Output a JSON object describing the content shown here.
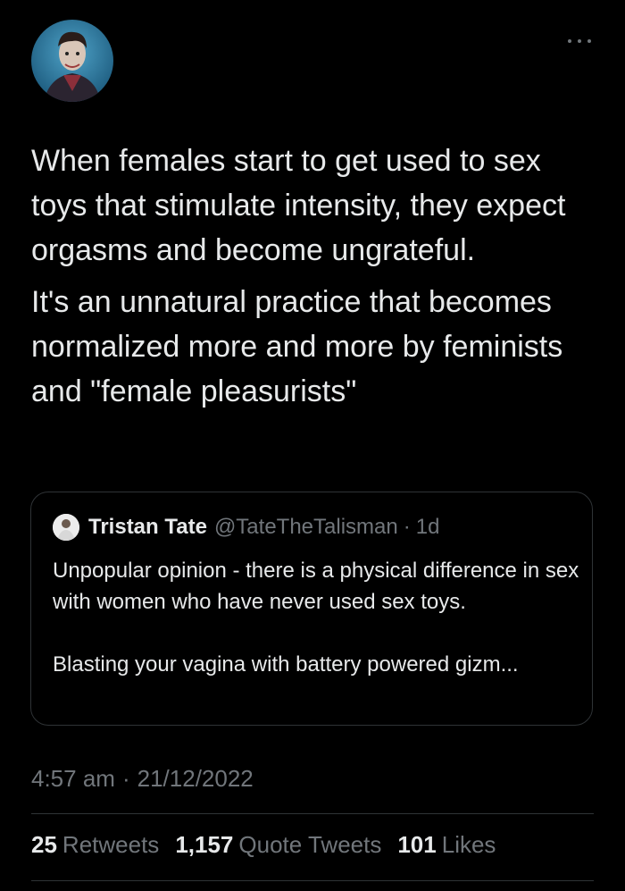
{
  "tweet": {
    "paragraphs": [
      "When females start to get used to sex toys that stimulate intensity, they expect orgasms and become ungrateful.",
      "It's an unnatural practice that becomes normalized more and more by feminists and \"female pleasurists\""
    ],
    "timestamp_time": "4:57 am",
    "separator": "·",
    "timestamp_date": "21/12/2022"
  },
  "quote": {
    "name": "Tristan Tate",
    "handle": "@TateTheTalisman",
    "separator": "·",
    "time": "1d",
    "line1": "Unpopular opinion - there is a physical difference in sex with women who have never used sex toys.",
    "line2": "Blasting your vagina with battery powered gizm..."
  },
  "stats": {
    "retweets_count": "25",
    "retweets_label": "Retweets",
    "quotes_count": "1,157",
    "quotes_label": "Quote Tweets",
    "likes_count": "101",
    "likes_label": "Likes"
  },
  "icons": {
    "more": "more-horizontal-icon",
    "avatar": "profile-avatar"
  },
  "colors": {
    "background": "#000000",
    "text": "#e7e9ea",
    "muted": "#71767b",
    "border": "#2f3336"
  }
}
